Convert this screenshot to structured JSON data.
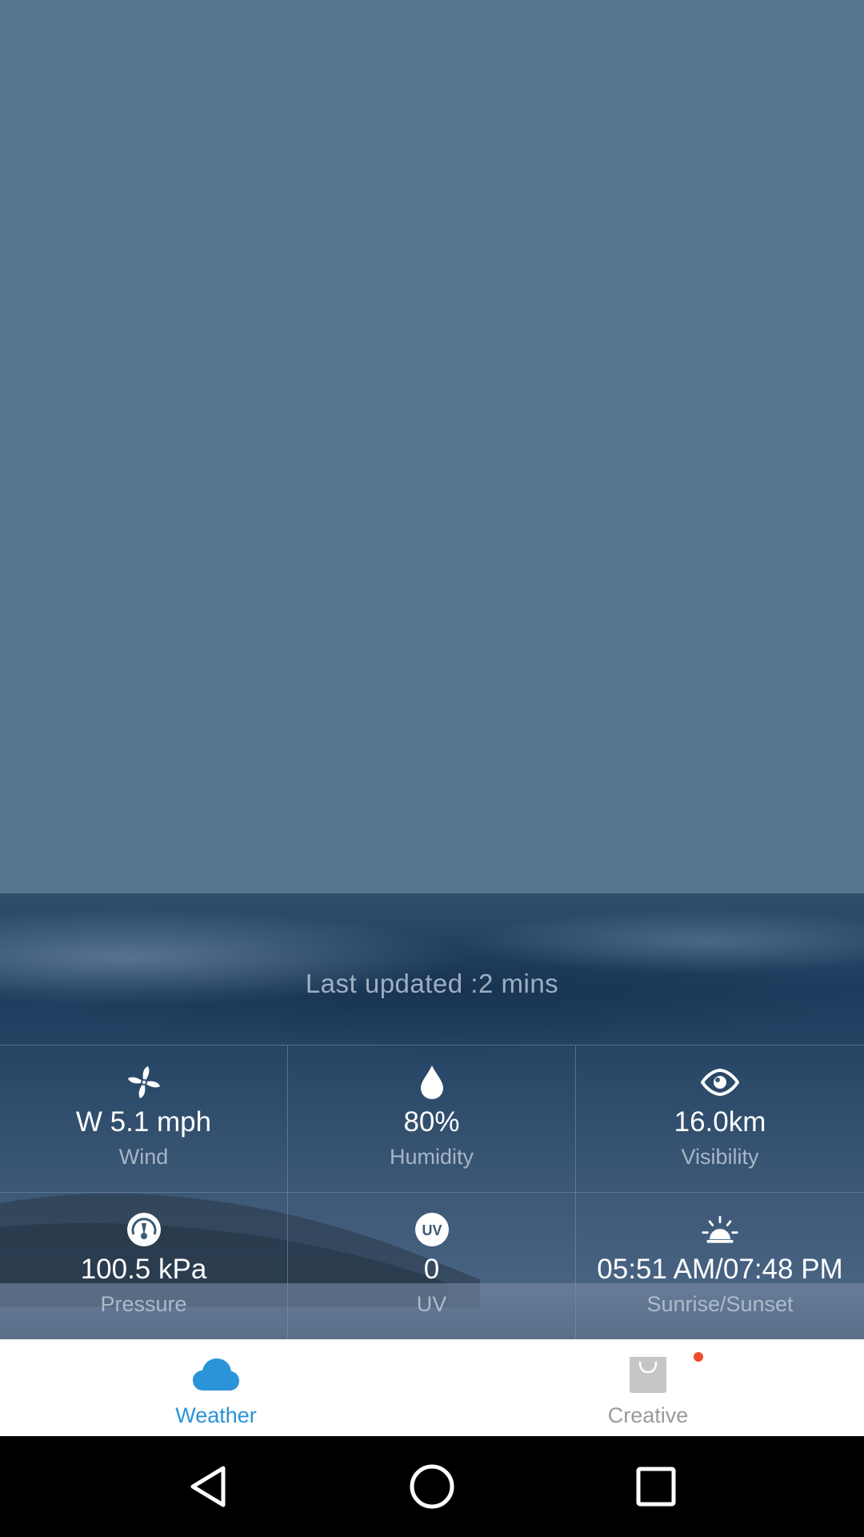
{
  "weather": {
    "last_updated": "Last updated :2 mins",
    "stats": [
      {
        "id": "wind",
        "icon": "fan-icon",
        "value": "W  5.1 mph",
        "label": "Wind"
      },
      {
        "id": "humidity",
        "icon": "droplet-icon",
        "value": "80%",
        "label": "Humidity"
      },
      {
        "id": "visibility",
        "icon": "eye-icon",
        "value": "16.0km",
        "label": "Visibility"
      },
      {
        "id": "pressure",
        "icon": "gauge-icon",
        "value": "100.5 kPa",
        "label": "Pressure"
      },
      {
        "id": "uv",
        "icon": "uv-icon",
        "value": "0",
        "label": "UV"
      },
      {
        "id": "sun",
        "icon": "sunrise-icon",
        "value": "05:51 AM/07:48 PM",
        "label": "Sunrise/Sunset"
      }
    ]
  },
  "bottom_nav": {
    "items": [
      {
        "label": "Weather",
        "icon": "cloud-icon",
        "active": true
      },
      {
        "label": "Creative",
        "icon": "shopping-bag-icon",
        "active": false,
        "badge": true
      }
    ]
  },
  "colors": {
    "top_background": "#58758F",
    "active_accent": "#2b93d8",
    "inactive_label": "#9a9a9a",
    "badge": "#f04a2c"
  }
}
